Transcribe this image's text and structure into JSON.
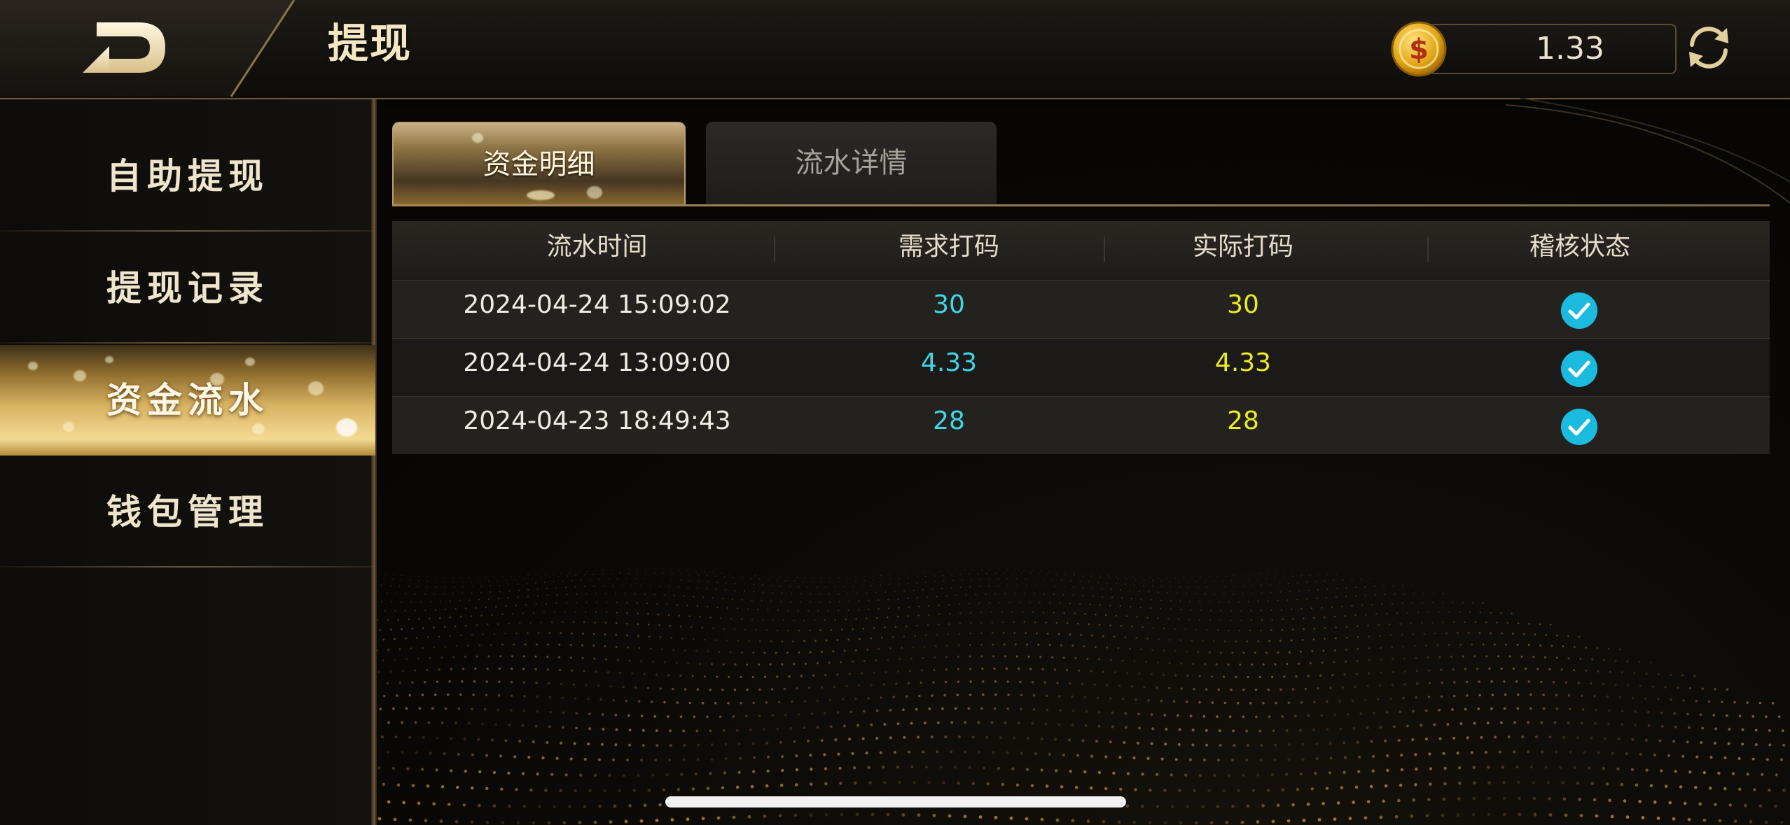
{
  "header": {
    "title": "提现",
    "balance": "1.33"
  },
  "sidebar": {
    "items": [
      {
        "label": "自助提现"
      },
      {
        "label": "提现记录"
      },
      {
        "label": "资金流水",
        "active": true
      },
      {
        "label": "钱包管理"
      }
    ]
  },
  "tabs": [
    {
      "label": "资金明细",
      "active": true
    },
    {
      "label": "流水详情",
      "active": false
    }
  ],
  "table": {
    "columns": [
      "流水时间",
      "需求打码",
      "实际打码",
      "稽核状态"
    ],
    "rows": [
      {
        "time": "2024-04-24 15:09:02",
        "required": "30",
        "actual": "30",
        "status": "check-icon"
      },
      {
        "time": "2024-04-24 13:09:00",
        "required": "4.33",
        "actual": "4.33",
        "status": "check-icon"
      },
      {
        "time": "2024-04-23 18:49:43",
        "required": "28",
        "actual": "28",
        "status": "check-icon"
      }
    ]
  },
  "colors": {
    "gold": "#d9b363",
    "required_value": "#3fd7ea",
    "actual_value": "#ecec1e",
    "check": "#1bbbe0"
  },
  "icons": [
    "back-arrow-icon",
    "coin-icon",
    "refresh-icon",
    "check-icon"
  ]
}
